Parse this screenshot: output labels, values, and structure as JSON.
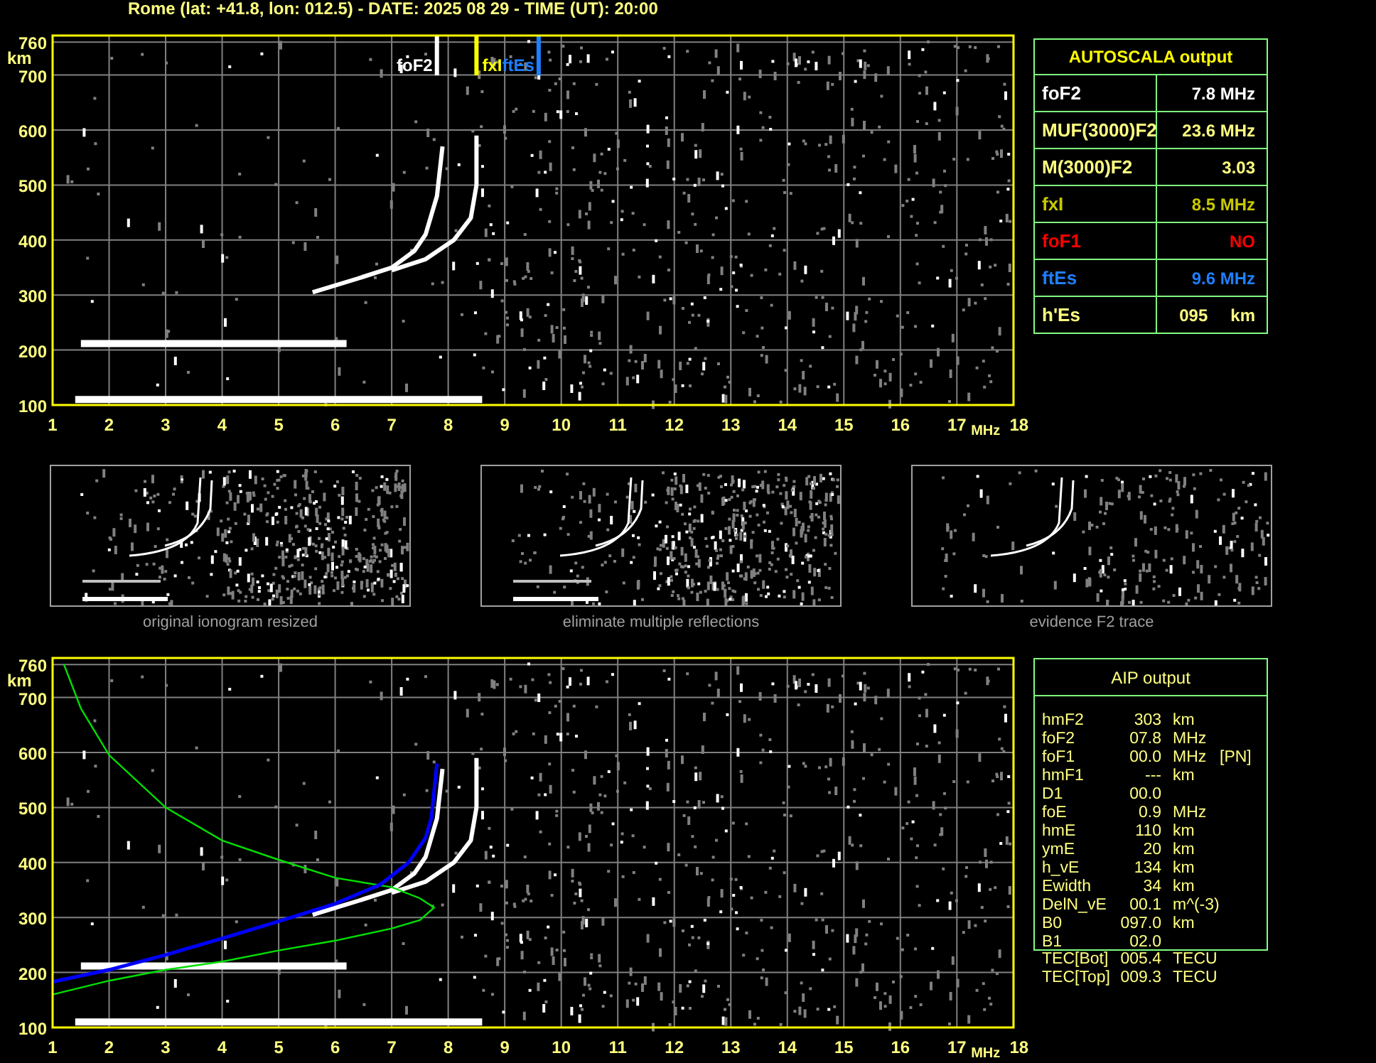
{
  "title": "Rome (lat: +41.8, lon: 012.5) - DATE: 2025 08 29 - TIME (UT): 20:00",
  "ionogram": {
    "y_ticks": [
      "760",
      "700",
      "600",
      "500",
      "400",
      "300",
      "200",
      "100"
    ],
    "y_unit": "km",
    "x_ticks": [
      "1",
      "2",
      "3",
      "4",
      "5",
      "6",
      "7",
      "8",
      "9",
      "10",
      "11",
      "12",
      "13",
      "14",
      "15",
      "16",
      "17",
      "18"
    ],
    "x_unit": "MHz",
    "markers": [
      {
        "label": "foF2",
        "color": "#ffffff"
      },
      {
        "label": "fxI",
        "color": "#ffff00"
      },
      {
        "label": "ftEs",
        "color": "#1e7fff"
      }
    ]
  },
  "thumbnails": [
    {
      "caption": "original ionogram resized",
      "kind": "original"
    },
    {
      "caption": "eliminate multiple reflections",
      "kind": "filtered"
    },
    {
      "caption": "evidence F2 trace",
      "kind": "f2"
    }
  ],
  "profile": {
    "y_ticks": [
      "760",
      "700",
      "600",
      "500",
      "400",
      "300",
      "200",
      "100"
    ],
    "y_unit": "km",
    "x_ticks": [
      "1",
      "2",
      "3",
      "4",
      "5",
      "6",
      "7",
      "8",
      "9",
      "10",
      "11",
      "12",
      "13",
      "14",
      "15",
      "16",
      "17",
      "18"
    ],
    "x_unit": "MHz"
  },
  "autoscala": {
    "title": "AUTOSCALA output",
    "rows": [
      {
        "label": "foF2",
        "value": "7.8 MHz",
        "color": "#ffffff"
      },
      {
        "label": "MUF(3000)F2",
        "value": "23.6 MHz",
        "color": "#ffff80"
      },
      {
        "label": "M(3000)F2",
        "value": "3.03",
        "color": "#ffff80"
      },
      {
        "label": "fxI",
        "value": "8.5 MHz",
        "color": "#c8c800"
      },
      {
        "label": "foF1",
        "value": "NO",
        "color": "#ff0000"
      },
      {
        "label": "ftEs",
        "value": "9.6 MHz",
        "color": "#1e7fff"
      },
      {
        "label": "h'Es",
        "value": "095",
        "unit": "km",
        "color": "#ffff80"
      }
    ]
  },
  "aip": {
    "title": "AIP output",
    "rows": [
      {
        "name": "hmF2",
        "value": "303",
        "unit": "km"
      },
      {
        "name": "foF2",
        "value": "07.8",
        "unit": "MHz"
      },
      {
        "name": "foF1",
        "value": "00.0",
        "unit": "MHz",
        "note": "[PN]"
      },
      {
        "name": "hmF1",
        "value": "---",
        "unit": "km"
      },
      {
        "name": "D1",
        "value": "00.0"
      },
      {
        "name": "foE",
        "value": "0.9",
        "unit": "MHz"
      },
      {
        "name": "hmE",
        "value": "110",
        "unit": "km"
      },
      {
        "name": "ymE",
        "value": "20",
        "unit": "km"
      },
      {
        "name": "h_vE",
        "value": "134",
        "unit": "km"
      },
      {
        "name": "Ewidth",
        "value": "34",
        "unit": "km"
      },
      {
        "name": "DelN_vE",
        "value": "00.1",
        "unit": "m^(-3)"
      },
      {
        "name": "B0",
        "value": "097.0",
        "unit": "km"
      },
      {
        "name": "B1",
        "value": "02.0"
      }
    ],
    "footer_rows": [
      {
        "name": "TEC[Bot]",
        "value": "005.4",
        "unit": "TECU"
      },
      {
        "name": "TEC[Top]",
        "value": "009.3",
        "unit": "TECU"
      }
    ]
  }
}
